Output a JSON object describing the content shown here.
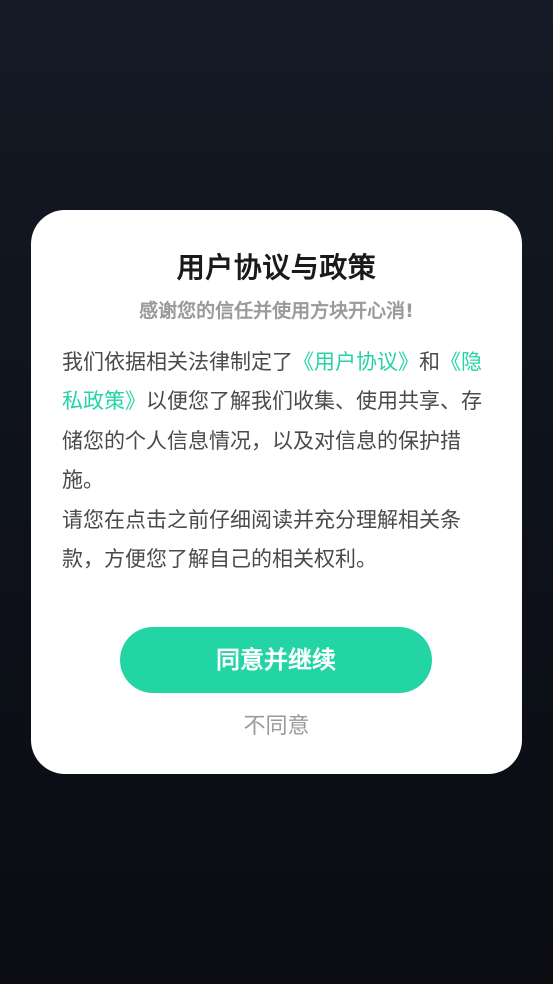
{
  "dialog": {
    "title": "用户协议与政策",
    "subtitle": "感谢您的信任并使用方块开心消!",
    "paragraph1": {
      "intro": "我们依据相关法律制定了",
      "user_agreement_link": "《用户协议》",
      "conjunction": "和",
      "privacy_policy_link": "《隐私政策》",
      "rest": "以便您了解我们收集、使用共享、存储您的个人信息情况，以及对信息的保护措施。"
    },
    "paragraph2": "请您在点击之前仔细阅读并充分理解相关条款，方便您了解自己的相关权利。",
    "agree_button": "同意并继续",
    "disagree_button": "不同意"
  },
  "colors": {
    "accent": "#23d4a4",
    "background": "#0f131c",
    "dialog_background": "#ffffff"
  }
}
